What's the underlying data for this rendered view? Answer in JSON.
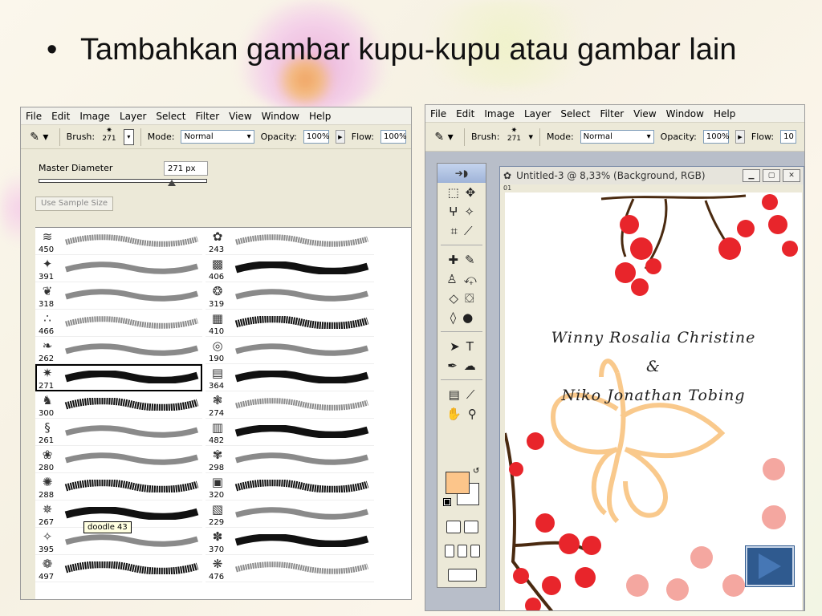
{
  "slide": {
    "bullet": "•",
    "text": "Tambahkan gambar kupu-kupu atau gambar lain"
  },
  "left_window": {
    "menu": [
      "File",
      "Edit",
      "Image",
      "Layer",
      "Select",
      "Filter",
      "View",
      "Window",
      "Help"
    ],
    "options": {
      "brush_label": "Brush:",
      "brush_size": "271",
      "mode_label": "Mode:",
      "mode_value": "Normal",
      "opacity_label": "Opacity:",
      "opacity_value": "100%",
      "flow_label": "Flow:",
      "flow_value": "100%"
    },
    "brush_picker": {
      "master_diameter_label": "Master Diameter",
      "master_diameter_value": "271 px",
      "use_sample_size_label": "Use Sample Size",
      "tooltip": "doodle 43",
      "col1": [
        {
          "icon": "≋",
          "num": "450"
        },
        {
          "icon": "✦",
          "num": "391"
        },
        {
          "icon": "❦",
          "num": "318"
        },
        {
          "icon": "∴",
          "num": "466"
        },
        {
          "icon": "❧",
          "num": "262"
        },
        {
          "icon": "✷",
          "num": "271"
        },
        {
          "icon": "♞",
          "num": "300"
        },
        {
          "icon": "§",
          "num": "261"
        },
        {
          "icon": "❀",
          "num": "280"
        },
        {
          "icon": "✺",
          "num": "288"
        },
        {
          "icon": "✵",
          "num": "267"
        },
        {
          "icon": "✧",
          "num": "395"
        },
        {
          "icon": "❁",
          "num": "497"
        }
      ],
      "col2": [
        {
          "icon": "✿",
          "num": "243"
        },
        {
          "icon": "▩",
          "num": "406"
        },
        {
          "icon": "❂",
          "num": "319"
        },
        {
          "icon": "▦",
          "num": "410"
        },
        {
          "icon": "◎",
          "num": "190"
        },
        {
          "icon": "▤",
          "num": "364"
        },
        {
          "icon": "❃",
          "num": "274"
        },
        {
          "icon": "▥",
          "num": "482"
        },
        {
          "icon": "✾",
          "num": "298"
        },
        {
          "icon": "▣",
          "num": "320"
        },
        {
          "icon": "▧",
          "num": "229"
        },
        {
          "icon": "✽",
          "num": "370"
        },
        {
          "icon": "❋",
          "num": "476"
        }
      ]
    }
  },
  "right_window": {
    "menu": [
      "File",
      "Edit",
      "Image",
      "Layer",
      "Select",
      "Filter",
      "View",
      "Window",
      "Help"
    ],
    "options": {
      "brush_label": "Brush:",
      "brush_size": "271",
      "mode_label": "Mode:",
      "mode_value": "Normal",
      "opacity_label": "Opacity:",
      "opacity_value": "100%",
      "flow_label": "Flow:",
      "flow_value": "10"
    },
    "document": {
      "title": "Untitled-3 @ 8,33% (Background, RGB)",
      "ruler": "01",
      "line1": "Winny Rosalia Christine",
      "line2": "&",
      "line3": "Niko Jonathan Tobing"
    },
    "colors": {
      "foreground": "#fcc58a",
      "background": "#ffffff",
      "butterfly": "#f9c98c",
      "blossom": "#e8252b",
      "peach_flower": "#f4a7a0",
      "branch": "#4a2a10"
    }
  },
  "nav": {
    "next_icon": "next-slide-icon"
  }
}
